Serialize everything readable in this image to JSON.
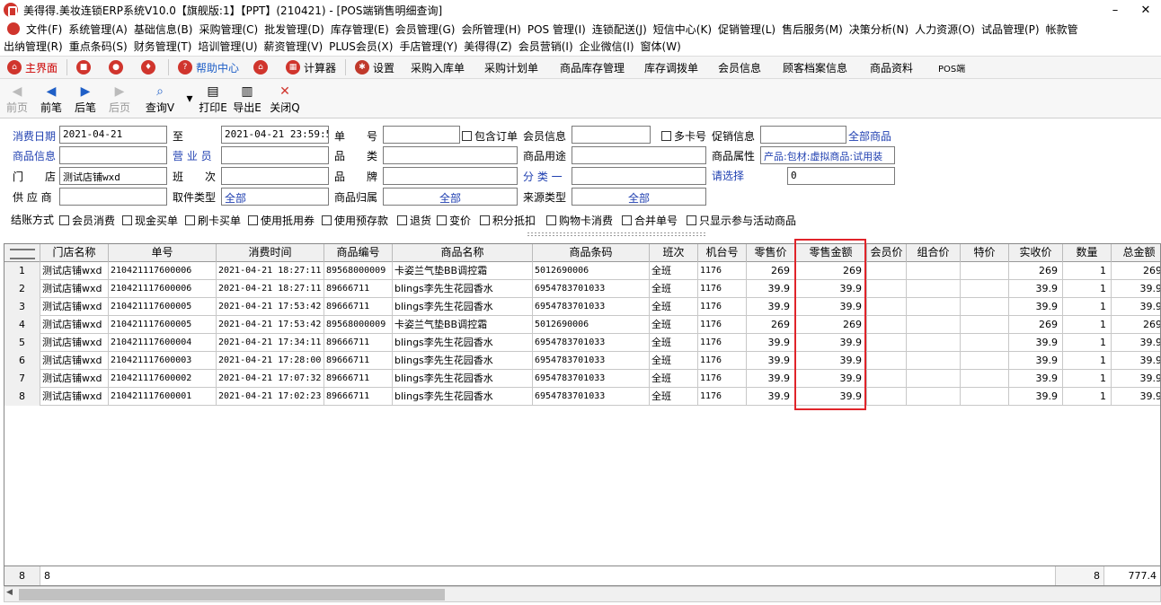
{
  "window": {
    "title": "美得得.美妆连锁ERP系统V10.0【旗舰版:1】【PPT】(210421) - [POS端销售明细查询]",
    "minimize": "–",
    "close": "✕"
  },
  "menu": {
    "row1": [
      "文件(F)",
      "系统管理(A)",
      "基础信息(B)",
      "采购管理(C)",
      "批发管理(D)",
      "库存管理(E)",
      "会员管理(G)",
      "会所管理(H)",
      "POS 管理(I)",
      "连锁配送(J)",
      "短信中心(K)",
      "促销管理(L)",
      "售后服务(M)",
      "决策分析(N)",
      "人力资源(O)",
      "试品管理(P)",
      "帐款管"
    ],
    "row2": [
      "出纳管理(R)",
      "重点条码(S)",
      "财务管理(T)",
      "培训管理(U)",
      "薪资管理(V)",
      "PLUS会员(X)",
      "手店管理(Y)",
      "美得得(Z)",
      "会员营销(I)",
      "企业微信(I)",
      "窗体(W)"
    ]
  },
  "quickbar": {
    "home": "主界面",
    "help": "帮助中心",
    "calc": "计算器",
    "settings": "设置",
    "items": [
      "采购入库单",
      "采购计划单",
      "商品库存管理",
      "库存调拨单",
      "会员信息",
      "顾客档案信息",
      "商品资料",
      "POS端"
    ]
  },
  "toolbar": {
    "first": "前页",
    "prev": "前笔",
    "next": "后笔",
    "last": "后页",
    "query": "查询V",
    "print": "打印E",
    "export": "导出E",
    "close": "关闭Q"
  },
  "filters": {
    "date_label": "消费日期",
    "date_from": "2021-04-21",
    "to_label": "至",
    "date_to": "2021-04-21 23:59:59",
    "order_label": "单　　号",
    "include_order": "包含订单",
    "member_label": "会员信息",
    "multi_card": "多卡号",
    "promo_label": "促销信息",
    "promo_value": "全部商品",
    "goods_label": "商品信息",
    "clerk_label": "营 业 员",
    "category_label": "品　　类",
    "use_label": "商品用途",
    "attr_label": "商品属性",
    "attr_value": "产品:包材:虚拟商品:试用装",
    "store_label": "门　　店",
    "store_value": "测试店铺wxd",
    "shift_label": "班　　次",
    "brand_label": "品　　牌",
    "class_label": "分 类 一",
    "please_select": "请选择",
    "please_value": "0",
    "supplier_label": "供 应 商",
    "pick_label": "取件类型",
    "pick_value": "全部",
    "goods_belong_label": "商品归属",
    "goods_belong_value": "全部",
    "source_label": "来源类型",
    "source_value": "全部",
    "settle_label": "结账方式",
    "settle_options": [
      "会员消费",
      "现金买单",
      "刷卡买单",
      "使用抵用券",
      "使用预存款",
      "退货",
      "变价",
      "积分抵扣",
      "购物卡消费",
      "合并单号",
      "只显示参与活动商品"
    ]
  },
  "table": {
    "headers": [
      "门店名称",
      "单号",
      "消费时间",
      "商品编号",
      "商品名称",
      "商品条码",
      "班次",
      "机台号",
      "零售价",
      "零售金额",
      "会员价",
      "组合价",
      "特价",
      "实收价",
      "数量",
      "总金额"
    ],
    "rows": [
      [
        "1",
        "测试店铺wxd",
        "210421117600006",
        "2021-04-21 18:27:11",
        "89568000009",
        "卡姿兰气垫BB调控霜",
        "5012690006",
        "全班",
        "1176",
        "269",
        "269",
        "",
        "",
        "",
        "269",
        "1",
        "269"
      ],
      [
        "2",
        "测试店铺wxd",
        "210421117600006",
        "2021-04-21 18:27:11",
        "89666711",
        "blings李先生花园香水",
        "6954783701033",
        "全班",
        "1176",
        "39.9",
        "39.9",
        "",
        "",
        "",
        "39.9",
        "1",
        "39.9"
      ],
      [
        "3",
        "测试店铺wxd",
        "210421117600005",
        "2021-04-21 17:53:42",
        "89666711",
        "blings李先生花园香水",
        "6954783701033",
        "全班",
        "1176",
        "39.9",
        "39.9",
        "",
        "",
        "",
        "39.9",
        "1",
        "39.9"
      ],
      [
        "4",
        "测试店铺wxd",
        "210421117600005",
        "2021-04-21 17:53:42",
        "89568000009",
        "卡姿兰气垫BB调控霜",
        "5012690006",
        "全班",
        "1176",
        "269",
        "269",
        "",
        "",
        "",
        "269",
        "1",
        "269"
      ],
      [
        "5",
        "测试店铺wxd",
        "210421117600004",
        "2021-04-21 17:34:11",
        "89666711",
        "blings李先生花园香水",
        "6954783701033",
        "全班",
        "1176",
        "39.9",
        "39.9",
        "",
        "",
        "",
        "39.9",
        "1",
        "39.9"
      ],
      [
        "6",
        "测试店铺wxd",
        "210421117600003",
        "2021-04-21 17:28:00",
        "89666711",
        "blings李先生花园香水",
        "6954783701033",
        "全班",
        "1176",
        "39.9",
        "39.9",
        "",
        "",
        "",
        "39.9",
        "1",
        "39.9"
      ],
      [
        "7",
        "测试店铺wxd",
        "210421117600002",
        "2021-04-21 17:07:32",
        "89666711",
        "blings李先生花园香水",
        "6954783701033",
        "全班",
        "1176",
        "39.9",
        "39.9",
        "",
        "",
        "",
        "39.9",
        "1",
        "39.9"
      ],
      [
        "8",
        "测试店铺wxd",
        "210421117600001",
        "2021-04-21 17:02:23",
        "89666711",
        "blings李先生花园香水",
        "6954783701033",
        "全班",
        "1176",
        "39.9",
        "39.9",
        "",
        "",
        "",
        "39.9",
        "1",
        "39.9"
      ]
    ],
    "footer": {
      "count_left": "8",
      "count": "8",
      "qty_total": "8",
      "amount_total": "777.4"
    }
  },
  "colors": {
    "highlight": "#e0242a",
    "link": "#1f3fb0"
  }
}
